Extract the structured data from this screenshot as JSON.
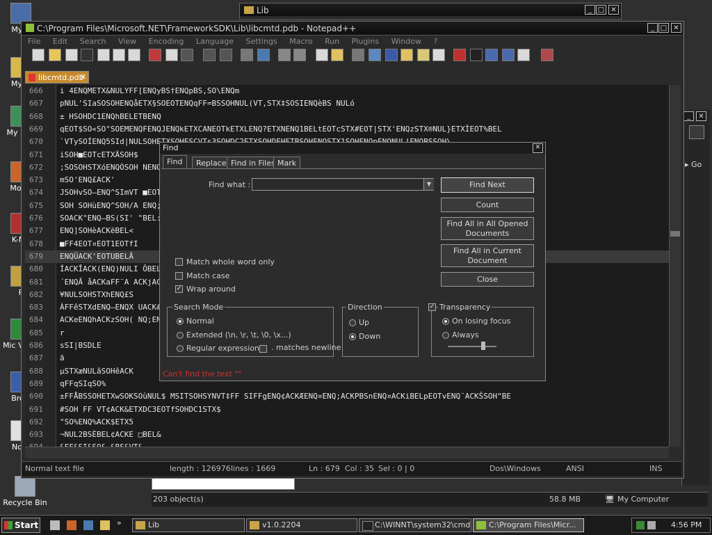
{
  "desktop": {
    "icons": [
      {
        "label": "My C"
      },
      {
        "label": "My D"
      },
      {
        "label": "My N Pl"
      },
      {
        "label": "Mozill"
      },
      {
        "label": "K-Me"
      },
      {
        "label": "P"
      },
      {
        "label": "Mic Visua"
      },
      {
        "label": "Brow"
      },
      {
        "label": "Note"
      },
      {
        "label": "Recycle Bin"
      }
    ]
  },
  "explorer_window": {
    "title": "Lib",
    "status_objects": "203 object(s)",
    "status_size": "58.8 MB",
    "status_location": "My Computer",
    "go_label": "Go"
  },
  "notepad": {
    "title": "C:\\Program Files\\Microsoft.NET\\FrameworkSDK\\Lib\\libcmtd.pdb - Notepad++",
    "menu": [
      "File",
      "Edit",
      "Search",
      "View",
      "Encoding",
      "Language",
      "Settings",
      "Macro",
      "Run",
      "Plugins",
      "Window",
      "?"
    ],
    "tab_label": "libcmtd.pdb",
    "lines": [
      {
        "num": "666",
        "text": "i    4ENQMETX&NULYFF[ENQyBS†ENQpBS,SO\\ENQm"
      },
      {
        "num": "667",
        "text": "pNUL'SIaSOSOHENQåETX§SOEOTENQqFF=BSSOHNUL(VT,STX‡SOSIENQèBS NULó"
      },
      {
        "num": "668",
        "text": "±   HSOHDC1ENQhBELETBENQ"
      },
      {
        "num": "669",
        "text": "    qEOT$SO«SO°SOEMENQFENQJENQkETXCANEOTkETXLENQ?ETXNENQ1BELtEOTcSTX#EOT|STX'ENQzSTX®NUL}ETXÌEOT%BEL"
      },
      {
        "num": "670",
        "text": "`VTySOÍENQ5SId|NULSOHETXSOHESCVTs3SOHDC2ETXSOHDEHETBSOHENQSTX1SOHENQpENQNUL!ENQBSSOH\\"
      },
      {
        "num": "671",
        "text": "iSOH■EOTcETXÄSOH$"
      },
      {
        "num": "672",
        "text": ";SOSOHSTXóENQÒSOH                                                                 NENQÕACK6ENQBSSOHòEM"
      },
      {
        "num": "673",
        "text": "mSO'ENQ£ACK'"
      },
      {
        "num": "674",
        "text": "JSOHvSO—ENQ^SImVT                                                                 ■EOT£EOTgENQETBBEL‡$"
      },
      {
        "num": "675",
        "text": "SOH SOHùENQ^SOH/A                                                                 ENQ;ACK$BEL,ENQeBEL D"
      },
      {
        "num": "676",
        "text": "SOACK\"ENQ—BS(SI'                                                                 \"BEL:ETX■BSóSIòBELmE"
      },
      {
        "num": "677",
        "text": " ENQ]SOHèACKëBEL<"
      },
      {
        "num": "678",
        "text": "■FF4EOT¤EOT1EOTfI"
      },
      {
        "num": "679",
        "text": "ENQÜACK'EOTUBELÂ"
      },
      {
        "num": "680",
        "text": "ÍACKÎACK(ENQ)NULI                                                                 ÔBEL†ACKÔACKùNUL■ACK"
      },
      {
        "num": "681",
        "text": "´ENQÂ   åACKaFF¨A                                                                 ACKjACKNBELSYNBEL—FF"
      },
      {
        "num": "682",
        "text": "¥NULSOHSTXhENQ£S                                                                 "
      },
      {
        "num": "683",
        "text": "ÀFFêSTXdENQ—ENQX                                                                 UACK#BEL%SOHbEOTfNUL"
      },
      {
        "num": "684",
        "text": "ACKeENQhACKzSOH(                                                                 NQ;ENQÂBEL¹EOTáSISI"
      },
      {
        "num": "685",
        "text": "r"
      },
      {
        "num": "686",
        "text": "sSI|BSDLE"
      },
      {
        "num": "687",
        "text": "ã"
      },
      {
        "num": "688",
        "text": "µSTXæNULâSOHêACK"
      },
      {
        "num": "689",
        "text": "qFFqSIqSO%"
      },
      {
        "num": "690",
        "text": "±FFÅBSSOHETXwSOKSOùNUL$  MSITSOHSYNVT‡FF SIFFgENQ¢ACKÆENQ¤ENQ;ACKPBSnENQ¤ACKiBELpEOTvENQ¨ACKŠSOH\"BE"
      },
      {
        "num": "691",
        "text": "#SOH FF VT¢ACK&ETXDC3EOTfSOHDC1STX$"
      },
      {
        "num": "692",
        "text": "\"SO%ENQ%ACK$ETX5"
      },
      {
        "num": "693",
        "text": "¬NUL2BSÈBEL¢ACKE  □BEL&"
      },
      {
        "num": "694",
        "text": "&FF&SI&SO& &BS&VT&"
      }
    ],
    "status": {
      "type": "Normal text file",
      "length": "length : 126976",
      "lines": "lines : 1669",
      "position": "Ln : 679",
      "col": "Col : 35",
      "sel": "Sel : 0 | 0",
      "eol": "Dos\\Windows",
      "encoding": "ANSI",
      "mode": "INS"
    }
  },
  "find_dialog": {
    "title": "Find",
    "tabs": [
      "Find",
      "Replace",
      "Find in Files",
      "Mark"
    ],
    "find_what_label": "Find what :",
    "find_what_value": "",
    "buttons": {
      "find_next": "Find Next",
      "count": "Count",
      "find_all_opened": "Find All in All Opened Documents",
      "find_all_current": "Find All in Current Document",
      "close": "Close"
    },
    "options": {
      "match_whole_word": "Match whole word only",
      "match_case": "Match case",
      "wrap_around": "Wrap around"
    },
    "search_mode": {
      "label": "Search Mode",
      "normal": "Normal",
      "extended": "Extended (\\n, \\r, \\t, \\0, \\x...)",
      "regex": "Regular expression",
      "matches_newline": ". matches newline"
    },
    "direction": {
      "label": "Direction",
      "up": "Up",
      "down": "Down"
    },
    "transparency": {
      "label": "Transparency",
      "on_losing_focus": "On losing focus",
      "always": "Always"
    },
    "status_message": "Can't find the text \"\""
  },
  "taskbar": {
    "start": "Start",
    "items": [
      "Lib",
      "v1.0.2204",
      "C:\\WINNT\\system32\\cmd....",
      "C:\\Program Files\\Micr..."
    ],
    "clock": "4:56 PM"
  }
}
